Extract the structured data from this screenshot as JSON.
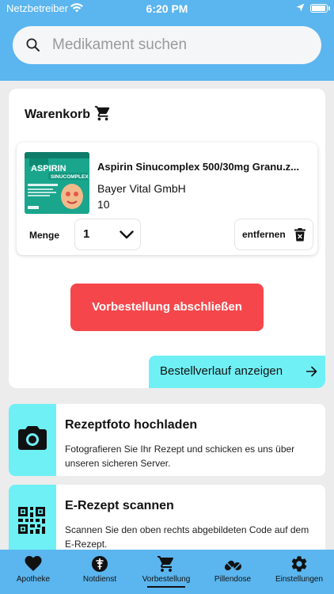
{
  "status_bar": {
    "carrier": "Netzbetreiber",
    "time": "6:20 PM"
  },
  "search": {
    "placeholder": "Medikament suchen",
    "icon": "search-icon"
  },
  "cart": {
    "title": "Warenkorb",
    "icon": "cart-icon",
    "item": {
      "name": "Aspirin Sinucomplex 500/30mg Granu.z...",
      "manufacturer": "Bayer Vital GmbH",
      "quantity_info": "10",
      "package_text": {
        "brand": "ASPIRIN",
        "sub": "SINUCOMPLEX"
      },
      "menge_label": "Menge",
      "menge_value": "1",
      "remove_label": "entfernen"
    },
    "preorder_button": "Vorbestellung abschließen",
    "history_button": "Bestellverlauf anzeigen"
  },
  "actions": [
    {
      "title": "Rezeptfoto hochladen",
      "description": "Fotografieren Sie Ihr Rezept und schicken es uns über unseren sicheren Server.",
      "icon": "camera-icon"
    },
    {
      "title": "E-Rezept scannen",
      "description": "Scannen Sie den oben rechts abgebildeten Code auf dem E-Rezept.",
      "icon": "qr-code-icon"
    }
  ],
  "tabs": [
    {
      "label": "Apotheke",
      "icon": "heart-icon"
    },
    {
      "label": "Notdienst",
      "icon": "medical-icon"
    },
    {
      "label": "Vorbestellung",
      "icon": "cart-icon",
      "active": true
    },
    {
      "label": "Pillendose",
      "icon": "pills-icon"
    },
    {
      "label": "Einstellungen",
      "icon": "gear-icon"
    }
  ],
  "colors": {
    "header": "#5bb5ee",
    "accent_cyan": "#6ff0f5",
    "primary_red": "#f5474b"
  }
}
